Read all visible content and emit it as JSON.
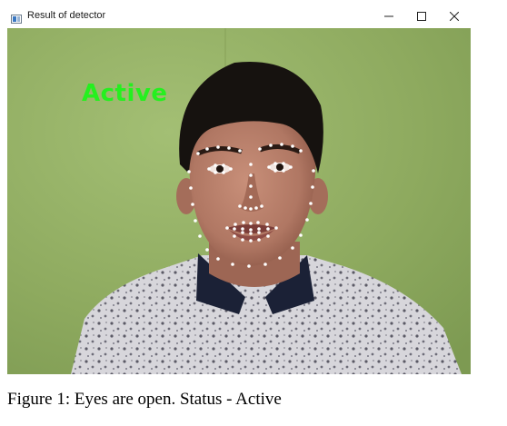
{
  "window": {
    "title": "Result of detector",
    "controls": {
      "minimize_icon": "minimize-icon",
      "maximize_icon": "maximize-icon",
      "close_icon": "close-icon"
    }
  },
  "video": {
    "overlay_text": "Active",
    "overlay_color": "#25f01f",
    "landmark_color": "#ffffff",
    "background_color": "#93b063"
  },
  "caption": "Figure 1: Eyes are open. Status - Active"
}
